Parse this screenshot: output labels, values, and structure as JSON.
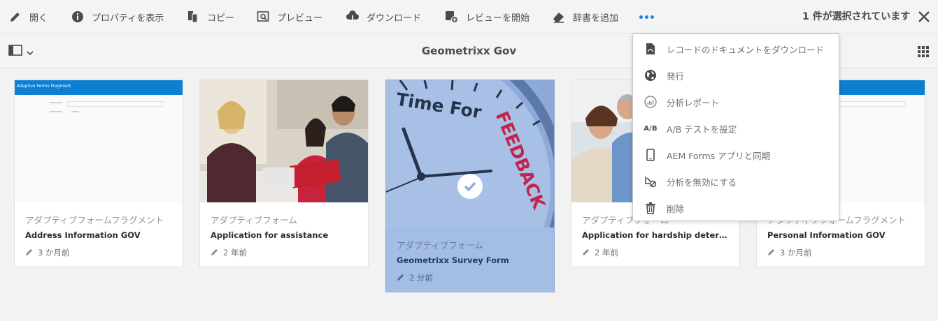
{
  "actionbar": {
    "open": "開く",
    "properties": "プロパティを表示",
    "copy": "コピー",
    "preview": "プレビュー",
    "download": "ダウンロード",
    "start_review": "レビューを開始",
    "add_dictionary": "辞書を追加",
    "selection_count": "1 件が選択されています"
  },
  "titlebar": {
    "title": "Geometrixx Gov"
  },
  "menu": [
    {
      "label": "レコードのドキュメントをダウンロード",
      "icon": "pdf-icon"
    },
    {
      "label": "発行",
      "icon": "globe-icon"
    },
    {
      "label": "分析レポート",
      "icon": "analytics-icon"
    },
    {
      "label": "A/B テストを設定",
      "icon": "ab-test-icon",
      "badge": "A/B"
    },
    {
      "label": "AEM Forms アプリと同期",
      "icon": "mobile-icon"
    },
    {
      "label": "分析を無効にする",
      "icon": "analytics-off-icon"
    },
    {
      "label": "削除",
      "icon": "trash-icon"
    }
  ],
  "cards": [
    {
      "type": "アダプティブフォームフラグメント",
      "name": "Address Information GOV",
      "modified": "3 か月前",
      "thumb_title": "Adaptive Forms Fragment"
    },
    {
      "type": "アダプティブフォーム",
      "name": "Application for assistance",
      "modified": "2 年前"
    },
    {
      "type": "アダプティブフォーム",
      "name": "Geometrixx Survey Form",
      "modified": "2 分前",
      "thumb_text_1": "Time For",
      "thumb_text_2": "FEEDBACK",
      "selected": true
    },
    {
      "type": "アダプティブフォーム",
      "name": "Application for hardship determinati…",
      "modified": "2 年前"
    },
    {
      "type": "アダプティブフォームフラグメント",
      "name": "Personal Information GOV",
      "modified": "3 か月前"
    }
  ],
  "colors": {
    "accent": "#2680eb",
    "selected_card": "#a4bde4",
    "fragment_header": "#0d7fd2"
  }
}
